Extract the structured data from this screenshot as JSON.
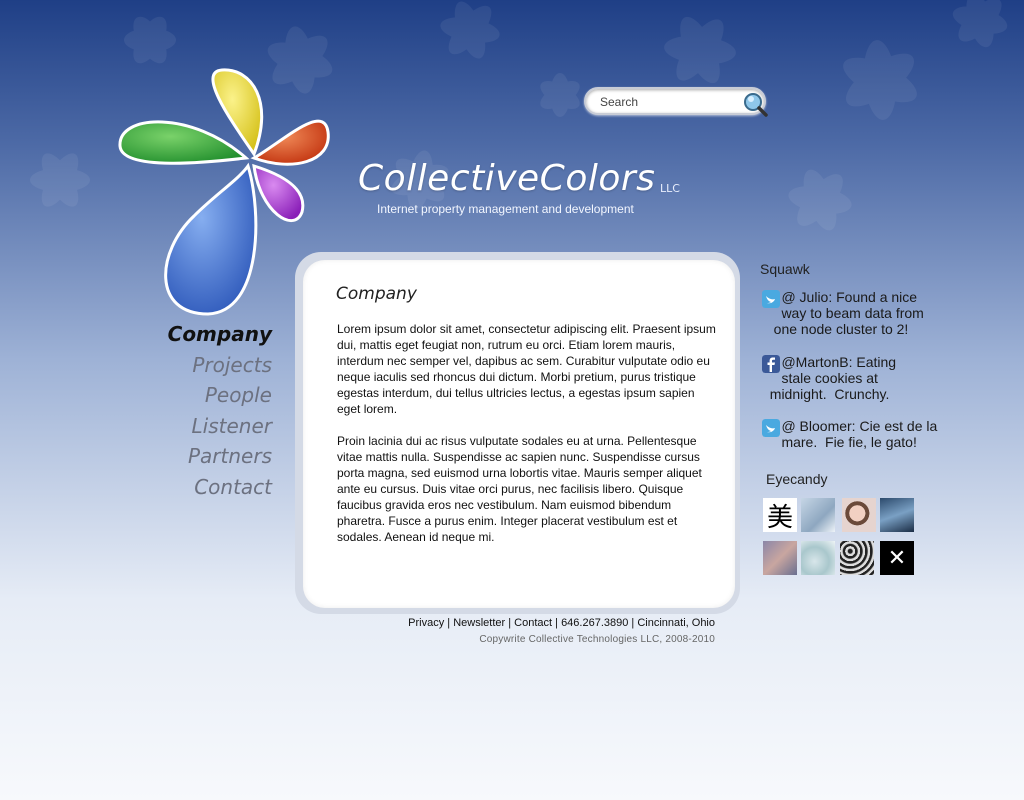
{
  "brand": {
    "name": "CollectiveColors",
    "suffix": "LLC",
    "tagline": "Internet property management and development"
  },
  "search": {
    "placeholder": "Search"
  },
  "nav": {
    "items": [
      {
        "label": "Company",
        "active": true
      },
      {
        "label": "Projects",
        "active": false
      },
      {
        "label": "People",
        "active": false
      },
      {
        "label": "Listener",
        "active": false
      },
      {
        "label": "Partners",
        "active": false
      },
      {
        "label": "Contact",
        "active": false
      }
    ]
  },
  "content": {
    "title": "Company",
    "paragraphs": [
      "Lorem ipsum dolor sit amet, consectetur adipiscing elit. Praesent ipsum dui, mattis eget feugiat non, rutrum eu orci. Etiam lorem mauris, interdum nec semper vel, dapibus ac sem. Curabitur vulputate odio eu neque iaculis sed rhoncus dui dictum. Morbi pretium, purus tristique egestas interdum, dui tellus ultricies lectus, a egestas ipsum sapien eget lorem.",
      "Proin lacinia dui ac risus vulputate sodales eu at urna. Pellentesque vitae mattis nulla. Suspendisse ac sapien nunc. Suspendisse cursus porta magna, sed euismod urna lobortis vitae. Mauris semper aliquet ante eu cursus. Duis vitae orci purus, nec facilisis libero. Quisque faucibus gravida eros nec vestibulum. Nam euismod bibendum pharetra. Fusce a purus enim. Integer placerat vestibulum est et sodales. Aenean id neque mi."
    ]
  },
  "footer": {
    "links": [
      "Privacy",
      "Newsletter",
      "Contact",
      "646.267.3890",
      "Cincinnati, Ohio"
    ],
    "separator": " | ",
    "copyright": "Copywrite Collective Technologies LLC, 2008-2010"
  },
  "sidebar": {
    "squawk_title": "Squawk",
    "tweets": [
      {
        "icon": "twitter-icon",
        "text": "     @ Julio: Found a nice\n     way to beam data from\n   one node cluster to 2!"
      },
      {
        "icon": "facebook-icon",
        "text": "     @MartonB: Eating\n     stale cookies at\n  midnight.  Crunchy."
      },
      {
        "icon": "twitter-icon",
        "text": "     @ Bloomer: Cie est de la\n     mare.  Fie fie, le gato!"
      }
    ],
    "eyecandy_title": "Eyecandy",
    "thumbnails": [
      "美",
      "",
      "",
      "",
      "",
      "",
      "",
      "✕"
    ]
  },
  "colors": {
    "bg_top": "#1f3f86",
    "bg_bottom": "#f7f9fc",
    "petal_yellow": "#e8d83a",
    "petal_red": "#d8441e",
    "petal_green": "#3aa84a",
    "petal_purple": "#a43ccc",
    "petal_blue": "#3f6fcf",
    "twitter_blue": "#4aa9e0",
    "facebook_blue": "#3b5998"
  }
}
